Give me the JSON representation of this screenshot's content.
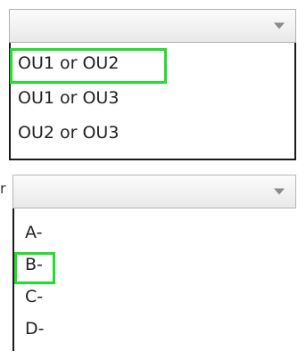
{
  "dropdown_1": {
    "selected_value": "",
    "options": [
      {
        "label": "OU1 or OU2",
        "highlighted": true
      },
      {
        "label": "OU1 or OU3",
        "highlighted": false
      },
      {
        "label": "OU2 or OU3",
        "highlighted": false
      }
    ]
  },
  "dropdown_2": {
    "prefix_char": "r",
    "selected_value": "",
    "options": [
      {
        "label": "A-",
        "highlighted": false
      },
      {
        "label": "B-",
        "highlighted": true
      },
      {
        "label": "C-",
        "highlighted": false
      },
      {
        "label": "D-",
        "highlighted": false
      }
    ]
  },
  "colors": {
    "highlight": "#22dd2a",
    "border": "#9a9a9a",
    "list_border": "#1a1a1a"
  },
  "icons": [
    "chevron-down-icon"
  ]
}
